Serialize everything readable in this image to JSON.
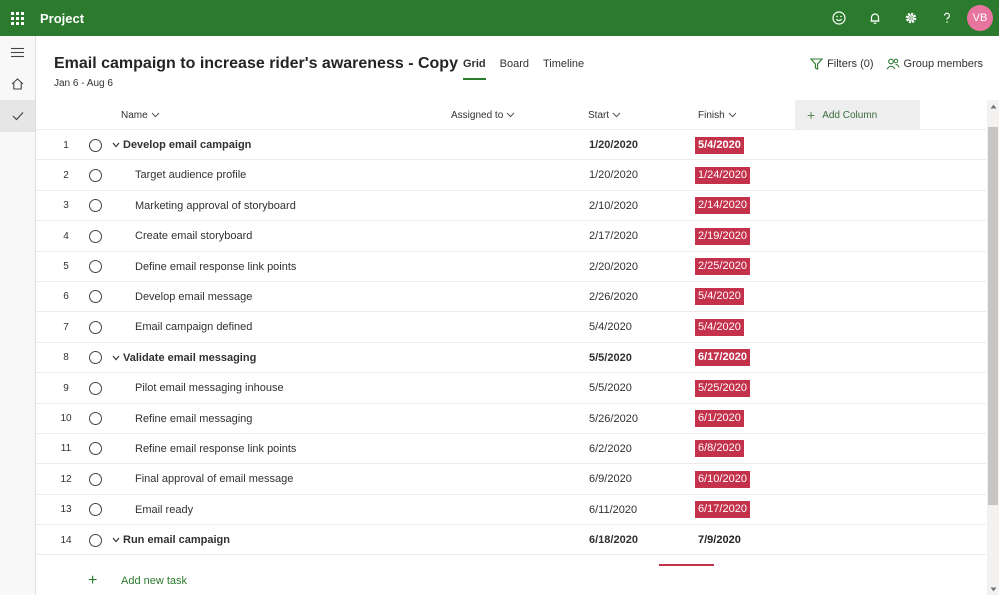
{
  "app": {
    "title": "Project",
    "avatar_initials": "VB",
    "brand_color": "#2b7a2e",
    "avatar_color": "#e8759e"
  },
  "top_icons": [
    "smiley-icon",
    "bell-icon",
    "gear-icon",
    "help-icon"
  ],
  "plan": {
    "title": "Email campaign to increase rider's awareness - Copy",
    "dates": "Jan 6 - Aug 6"
  },
  "tabs": [
    {
      "label": "Grid",
      "active": true
    },
    {
      "label": "Board",
      "active": false
    },
    {
      "label": "Timeline",
      "active": false
    }
  ],
  "toolbar": {
    "filters_label": "Filters (0)",
    "group_members_label": "Group members"
  },
  "columns": {
    "name": "Name",
    "assigned": "Assigned to",
    "start": "Start",
    "finish": "Finish",
    "add_column": "Add Column"
  },
  "late_color": "#c4314b",
  "tasks": [
    {
      "num": "1",
      "name": "Develop email campaign",
      "summary": true,
      "start": "1/20/2020",
      "finish": "5/4/2020",
      "late": true
    },
    {
      "num": "2",
      "name": "Target audience profile",
      "summary": false,
      "start": "1/20/2020",
      "finish": "1/24/2020",
      "late": true
    },
    {
      "num": "3",
      "name": "Marketing approval of storyboard",
      "summary": false,
      "start": "2/10/2020",
      "finish": "2/14/2020",
      "late": true
    },
    {
      "num": "4",
      "name": "Create email storyboard",
      "summary": false,
      "start": "2/17/2020",
      "finish": "2/19/2020",
      "late": true
    },
    {
      "num": "5",
      "name": "Define email response link points",
      "summary": false,
      "start": "2/20/2020",
      "finish": "2/25/2020",
      "late": true
    },
    {
      "num": "6",
      "name": "Develop email message",
      "summary": false,
      "start": "2/26/2020",
      "finish": "5/4/2020",
      "late": true
    },
    {
      "num": "7",
      "name": "Email campaign defined",
      "summary": false,
      "start": "5/4/2020",
      "finish": "5/4/2020",
      "late": true
    },
    {
      "num": "8",
      "name": "Validate email messaging",
      "summary": true,
      "start": "5/5/2020",
      "finish": "6/17/2020",
      "late": true
    },
    {
      "num": "9",
      "name": "Pilot email messaging inhouse",
      "summary": false,
      "start": "5/5/2020",
      "finish": "5/25/2020",
      "late": true
    },
    {
      "num": "10",
      "name": "Refine email messaging",
      "summary": false,
      "start": "5/26/2020",
      "finish": "6/1/2020",
      "late": true
    },
    {
      "num": "11",
      "name": "Refine email response link points",
      "summary": false,
      "start": "6/2/2020",
      "finish": "6/8/2020",
      "late": true
    },
    {
      "num": "12",
      "name": "Final approval of email message",
      "summary": false,
      "start": "6/9/2020",
      "finish": "6/10/2020",
      "late": true
    },
    {
      "num": "13",
      "name": "Email ready",
      "summary": false,
      "start": "6/11/2020",
      "finish": "6/17/2020",
      "late": true
    },
    {
      "num": "14",
      "name": "Run email campaign",
      "summary": true,
      "start": "6/18/2020",
      "finish": "7/9/2020",
      "late": false
    }
  ],
  "add_task_label": "Add new task"
}
